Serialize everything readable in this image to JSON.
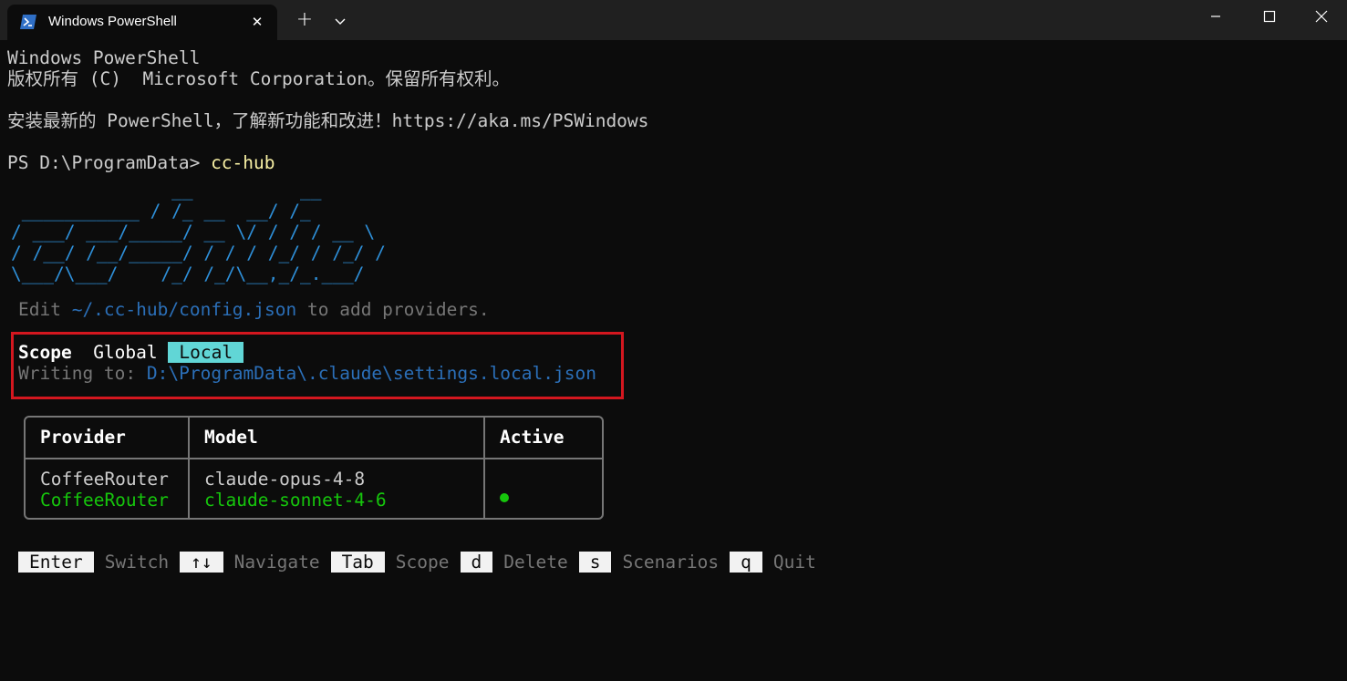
{
  "window": {
    "tab_title": "Windows PowerShell",
    "tab_icon": "powershell-icon",
    "new_tab_label": "+",
    "close_tab_glyph": "✕"
  },
  "terminal": {
    "banner_1": "Windows PowerShell",
    "banner_2": "版权所有 (C)  Microsoft Corporation。保留所有权利。",
    "banner_3": "安装最新的 PowerShell，了解新功能和改进！https://aka.ms/PSWindows",
    "prompt": "PS D:\\ProgramData> ",
    "command": "cc-hub",
    "ascii_logo": "               __          __\n ___________ / /_ __  __/ /_\n/ ___/ ___/_____/ __ \\/ / / / __ \\\n/ /__/ /__/_____/ / / / /_/ / /_/ /\n\\___/\\___/    /_/ /_/\\__,_/_.___/",
    "edit_prefix": "Edit ",
    "edit_path": "~/.cc-hub/config.json",
    "edit_suffix": " to add providers."
  },
  "scope": {
    "label": "Scope",
    "options": [
      "Global",
      "Local"
    ],
    "active": "Local",
    "writing_prefix": "Writing to: ",
    "writing_path": "D:\\ProgramData\\.claude\\settings.local.json"
  },
  "table": {
    "headers": [
      "Provider",
      "Model",
      "Active"
    ],
    "rows": [
      {
        "provider": "CoffeeRouter",
        "model": "claude-opus-4-8",
        "active": false
      },
      {
        "provider": "CoffeeRouter",
        "model": "claude-sonnet-4-6",
        "active": true
      }
    ]
  },
  "shortcuts": [
    {
      "key": "Enter",
      "label": "Switch"
    },
    {
      "key": "↑↓",
      "label": "Navigate"
    },
    {
      "key": "Tab",
      "label": "Scope"
    },
    {
      "key": "d",
      "label": "Delete"
    },
    {
      "key": "s",
      "label": "Scenarios"
    },
    {
      "key": "q",
      "label": "Quit"
    }
  ],
  "colors": {
    "background": "#0c0c0c",
    "ascii_blue": "#2e8fd8",
    "active_green": "#16c60c",
    "highlight_cyan": "#61d6d6",
    "box_red": "#d4171f"
  }
}
